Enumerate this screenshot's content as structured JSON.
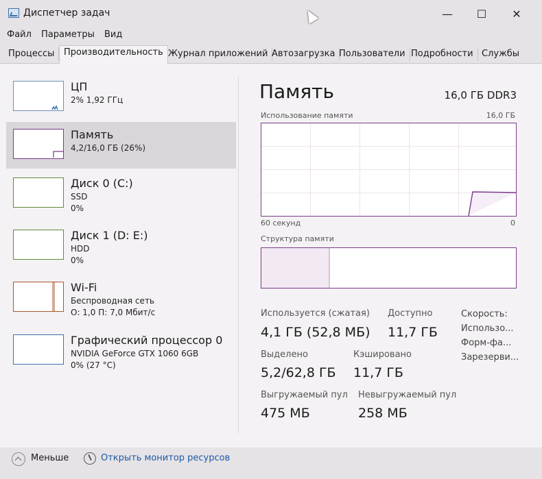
{
  "window": {
    "title": "Диспетчер задач",
    "minimize": "—",
    "maximize": "☐",
    "close": "✕"
  },
  "menu": [
    "Файл",
    "Параметры",
    "Вид"
  ],
  "tabs": [
    "Процессы",
    "Производительность",
    "Журнал приложений",
    "Автозагрузка",
    "Пользователи",
    "Подробности",
    "Службы"
  ],
  "sidebar": [
    {
      "name": "ЦП",
      "line1": "2% 1,92 ГГц",
      "line2": ""
    },
    {
      "name": "Память",
      "line1": "4,2/16,0 ГБ (26%)",
      "line2": ""
    },
    {
      "name": "Диск 0 (C:)",
      "line1": "SSD",
      "line2": "0%"
    },
    {
      "name": "Диск 1 (D: E:)",
      "line1": "HDD",
      "line2": "0%"
    },
    {
      "name": "Wi-Fi",
      "line1": "Беспроводная сеть",
      "line2": "О: 1,0 П: 7,0 Мбит/с"
    },
    {
      "name": "Графический процессор 0",
      "line1": "NVIDIA GeForce GTX 1060 6GB",
      "line2": "0% (27 °C)"
    }
  ],
  "memory": {
    "title": "Память",
    "type": "16,0 ГБ DDR3",
    "usage_label": "Использование памяти",
    "usage_max": "16,0 ГБ",
    "time_left": "60 секунд",
    "time_right": "0",
    "structure_label": "Структура памяти",
    "used_fraction": 0.26
  },
  "stats": {
    "in_use_label": "Используется (сжатая)",
    "in_use": "4,1 ГБ (52,8 МБ)",
    "available_label": "Доступно",
    "available": "11,7 ГБ",
    "committed_label": "Выделено",
    "committed": "5,2/62,8 ГБ",
    "cached_label": "Кэшировано",
    "cached": "11,7 ГБ",
    "paged_label": "Выгружаемый пул",
    "paged": "475 МБ",
    "nonpaged_label": "Невыгружаемый пул",
    "nonpaged": "258 МБ",
    "right": [
      "Скорость:",
      "Использо...",
      "Форм-фа...",
      "Зарезерви..."
    ]
  },
  "footer": {
    "less": "Меньше",
    "monitor": "Открыть монитор ресурсов"
  }
}
